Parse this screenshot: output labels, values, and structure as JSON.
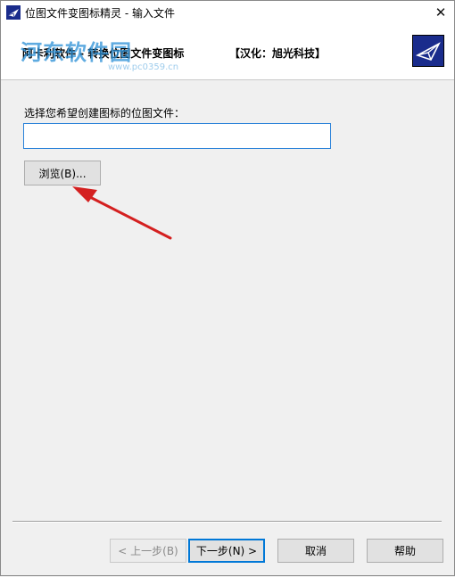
{
  "window": {
    "title": "位图文件变图标精灵 - 输入文件",
    "close_glyph": "✕"
  },
  "header": {
    "left_text": "阿卡利软件 - 转换位图文件变图标",
    "right_text": "【汉化：旭光科技】",
    "logo_icon": "paper-plane-logo-icon",
    "watermark_text": "河东软件园",
    "watermark_sub": "www.pc0359.cn"
  },
  "main": {
    "prompt_label": "选择您希望创建图标的位图文件：",
    "file_input_value": "",
    "file_input_placeholder": "",
    "browse_label": "浏览(B)..."
  },
  "footer": {
    "prev_label": "< 上一步(B)",
    "next_label": "下一步(N) >",
    "cancel_label": "取消",
    "help_label": "帮助"
  },
  "colors": {
    "accent": "#0078d7",
    "logo_bg": "#1a2c8c",
    "annotation_arrow": "#d42020",
    "watermark": "#2a8fd6"
  }
}
